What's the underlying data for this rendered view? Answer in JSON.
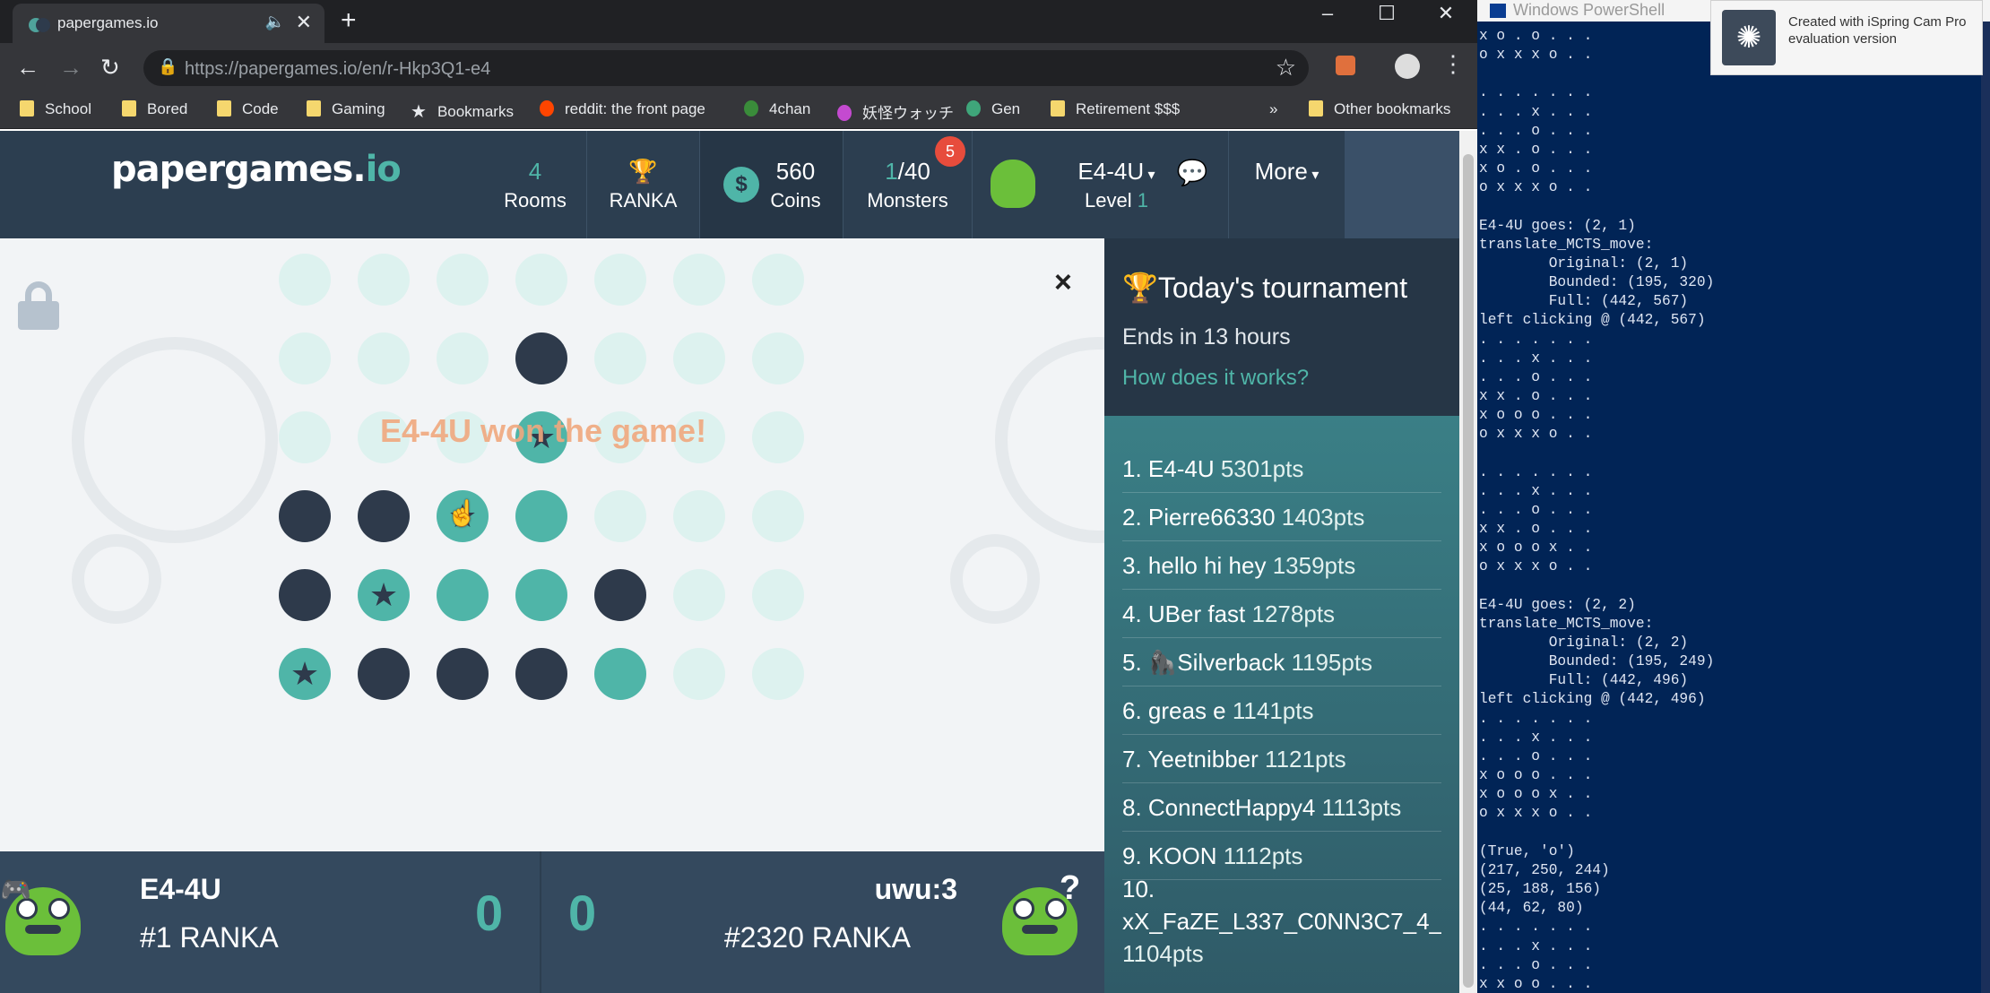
{
  "browser": {
    "tab_title": "papergames.io",
    "url": "https://papergames.io/en/r-Hkp3Q1-e4",
    "bookmarks": [
      "School",
      "Bored",
      "Code",
      "Gaming",
      "Bookmarks",
      "reddit: the front page",
      "4chan",
      "妖怪ウォッチ",
      "Gen",
      "Retirement $$$",
      "Other bookmarks"
    ],
    "overflow": "»"
  },
  "header": {
    "logo_main": "papergames.",
    "logo_io": "io",
    "rooms": {
      "num": "4",
      "label": "Rooms"
    },
    "ranka": {
      "label": "RANKA"
    },
    "coins": {
      "num": "560",
      "label": "Coins"
    },
    "monsters": {
      "num_a": "1",
      "num_b": "/40",
      "label": "Monsters",
      "badge": "5"
    },
    "user": {
      "name": "E4-4U",
      "level_word": "Level",
      "level_num": "1"
    },
    "more": "More"
  },
  "board": {
    "win_message": "E4-4U won the game!",
    "close": "×",
    "rows": [
      [
        "e",
        "e",
        "e",
        "e",
        "e",
        "e",
        "e"
      ],
      [
        "e",
        "e",
        "e",
        "d",
        "e",
        "e",
        "e"
      ],
      [
        "e",
        "e",
        "e",
        "ts",
        "e",
        "e",
        "e"
      ],
      [
        "d",
        "d",
        "ts",
        "t",
        "e",
        "e",
        "e"
      ],
      [
        "d",
        "ts",
        "t",
        "t",
        "d",
        "e",
        "e"
      ],
      [
        "ts",
        "d",
        "d",
        "d",
        "t",
        "e",
        "e"
      ]
    ]
  },
  "players": {
    "left": {
      "name": "E4-4U",
      "rank": "#1 RANKA",
      "score": "0"
    },
    "right": {
      "name": "uwu:3",
      "rank": "#2320 RANKA",
      "score": "0"
    }
  },
  "tournament": {
    "title": "Today's tournament",
    "ends": "Ends in 13 hours",
    "how": "How does it works?",
    "entries": [
      {
        "label": "1. E4-4U",
        "pts": "5301pts"
      },
      {
        "label": "2. Pierre66330",
        "pts": "1403pts"
      },
      {
        "label": "3. hello hi hey",
        "pts": "1359pts"
      },
      {
        "label": "4. UBer fast",
        "pts": "1278pts"
      },
      {
        "label": "5. 🦍Silverback",
        "pts": "1195pts"
      },
      {
        "label": "6. greas e",
        "pts": "1141pts"
      },
      {
        "label": "7. Yeetnibber",
        "pts": "1121pts"
      },
      {
        "label": "8. ConnectHappy4",
        "pts": "1113pts"
      },
      {
        "label": "9. KOON",
        "pts": "1112pts"
      }
    ],
    "last": {
      "rank": "10.",
      "name": "xX_FaZE_L337_C0NN3C7_4_Xx",
      "pts": "1104pts"
    }
  },
  "powershell": {
    "title": "Windows PowerShell",
    "console": "x o . o . . .\no x x x o . .\n\n. . . . . . .\n. . . x . . .\n. . . o . . .\nx x . o . . .\nx o . o . . .\no x x x o . .\n\nE4-4U goes: (2, 1)\ntranslate_MCTS_move:\n        Original: (2, 1)\n        Bounded: (195, 320)\n        Full: (442, 567)\nleft clicking @ (442, 567)\n. . . . . . .\n. . . x . . .\n. . . o . . .\nx x . o . . .\nx o o o . . .\no x x x o . .\n\n. . . . . . .\n. . . x . . .\n. . . o . . .\nx x . o . . .\nx o o o x . .\no x x x o . .\n\nE4-4U goes: (2, 2)\ntranslate_MCTS_move:\n        Original: (2, 2)\n        Bounded: (195, 249)\n        Full: (442, 496)\nleft clicking @ (442, 496)\n. . . . . . .\n. . . x . . .\n. . . o . . .\nx o o o . . .\nx o o o x . .\no x x x o . .\n\n(True, 'o')\n(217, 250, 244)\n(25, 188, 156)\n(44, 62, 80)\n. . . . . . .\n. . . x . . .\n. . . o . . .\nx x o o . . ."
  },
  "watermark": {
    "text": "Created with iSpring Cam Pro evaluation version"
  },
  "colors": {
    "dark_chip": "#2e3a4b",
    "teal_chip": "#4fb5a8",
    "empty_chip": "#ddf2ef",
    "header": "#2c3e50",
    "powershell_bg": "#012456"
  }
}
